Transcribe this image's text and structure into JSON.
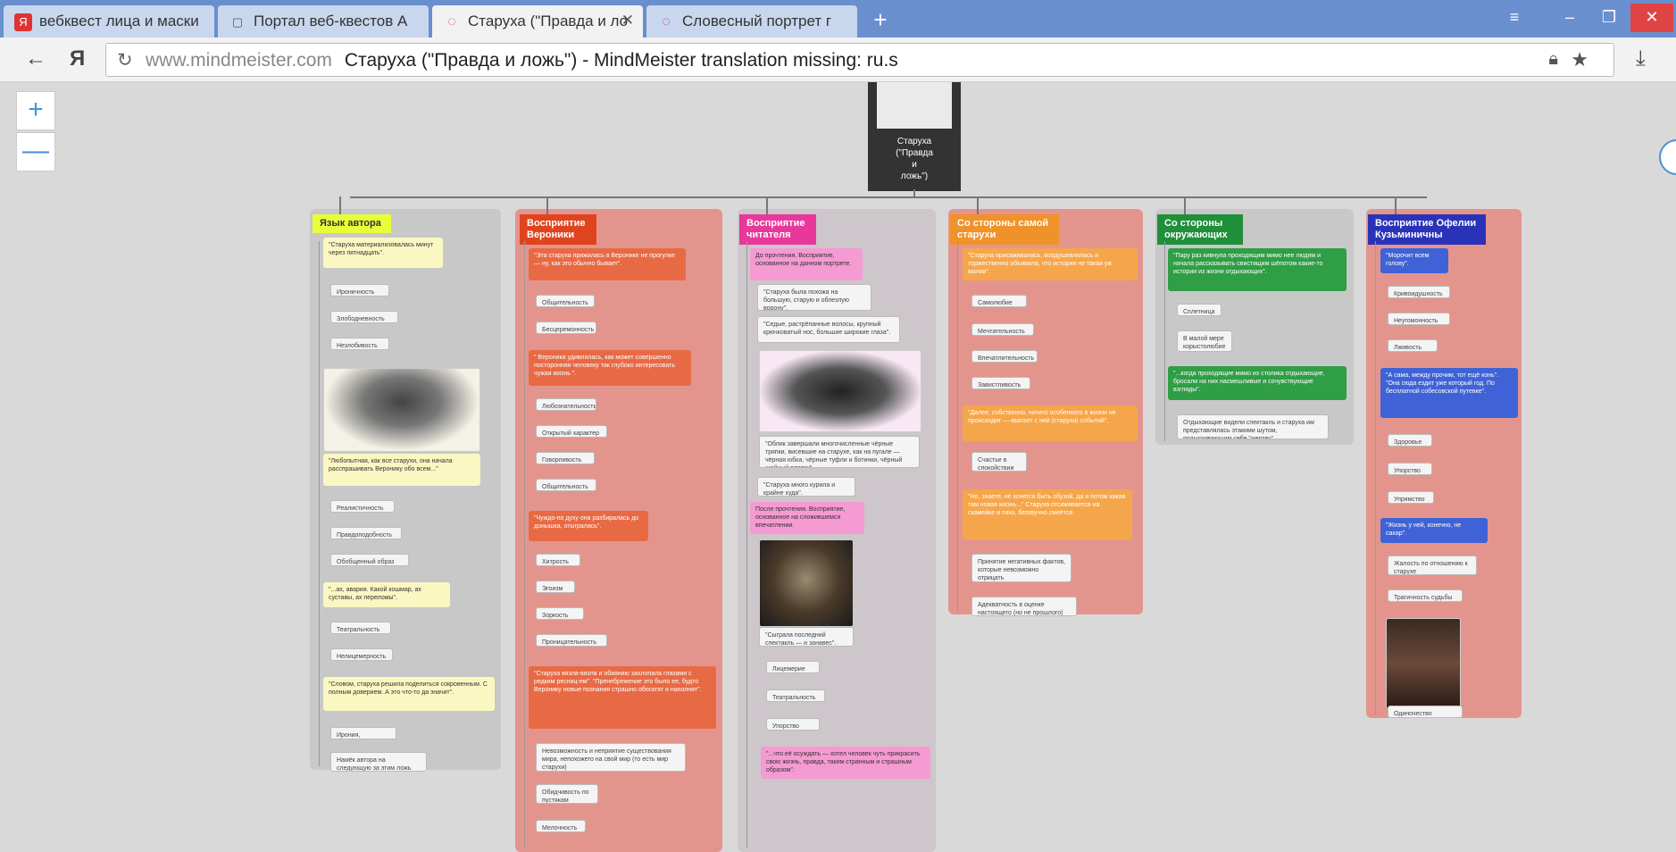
{
  "tabs": [
    {
      "label": "вебквест лица и маски",
      "icon": "Я"
    },
    {
      "label": "Портал веб-квестов А",
      "icon": "▢"
    },
    {
      "label": "Старуха (\"Правда и ло",
      "icon": "◌"
    },
    {
      "label": "Словесный портрет г",
      "icon": "◌"
    }
  ],
  "toolbar": {
    "back": "←",
    "brand": "Я",
    "domain": "www.mindmeister.com",
    "page_title": "Старуха (\"Правда и ложь\") - MindMeister translation missing: ru.s"
  },
  "zoom": {
    "plus": "+",
    "minus": "—"
  },
  "root": {
    "lines": [
      "Старуха",
      "(\"Правда",
      "и",
      "ложь\")"
    ]
  },
  "columns": [
    {
      "title": "Язык автора",
      "color": "#e8ff3a",
      "bg": "#c8c8c8"
    },
    {
      "title": "Восприятие Вероники",
      "color": "#e0441f",
      "bg": "#e3958d"
    },
    {
      "title": "Восприятие читателя",
      "color": "#e8389b",
      "bg": "#cdc6ca"
    },
    {
      "title": "Со стороны самой старухи",
      "color": "#f0922a",
      "bg": "#e3958d"
    },
    {
      "title": "Со стороны окружающих",
      "color": "#1f8f3a",
      "bg": "#c8c8c8"
    },
    {
      "title": "Восприятие Офелии Кузьминичны",
      "color": "#2a33b8",
      "bg": "#e3958d"
    }
  ],
  "nodes": {
    "c1": [
      "\"Старуха материализовалась минут через пятнадцать\".",
      "Ироничность",
      "Злободневность",
      "Незлобивость",
      "\"Любопытная, как все старухи, она начала расспрашивать Веронику обо всем...\"",
      "Реалистичность",
      "Правдоподобность",
      "Обобщенный образ",
      "\"...ах, авария. Какой кошмар, ах суставы, ах переломы\".",
      "Театральность",
      "Нелицемерность",
      "\"Словом, старуха решила поделиться сокровенным. С полным доверием. А это что-то да значит\".",
      "Ирония, насмешка",
      "Намёк автора на следующую за этим ложь"
    ],
    "c2": [
      "\"Эта старуха прижилась в Веронике не прогулке — ну, как это обычно бывает\".",
      "Общительность",
      "Бесцеремонность",
      "\" Вероника удивлялась, как может совершенно посторонняя человеку так глубоко интересовать чужая жизнь \".",
      "Любознательность",
      "Открытый характер",
      "Говорливость",
      "Общительность",
      "\"Чуждо-по духу она разбиралась до донышка, отыгралась\".",
      "Хитрость",
      "Эгоизм",
      "Зоркость",
      "Проницательность",
      "\"Старуха вязла-вязла и обаянию захлопала глазами с редким ресниц-ем\". \"Пренебрежение это было ее, будто Веронику новые познания страшно обогатят и наполнят\".",
      "Невозможность и неприятие существования мира, непохожего на свой мир (то есть мир старухи)",
      "Обидчивость по пустякам",
      "Мелочность"
    ],
    "c3": [
      "До прочтения. Восприятие, основанное на данном портрете.",
      "\"Старуха была похожа на большую, старую и облезлую ворону\".",
      "\"Седые, растрёпанные волосы, крупный крючковатый нос, большие широкие глаза\".",
      "\"Облик завершали многочисленные чёрные тряпки, висевшие на старухе, как на пугале — чёрная юбка, чёрные туфли и ботинки, чёрный шейный платок\".",
      "\"Старуха много курила и крайне худа\".",
      "После прочтения. Восприятие, основанное на сложившемся впечатлении.",
      "\"Сыграла последний спектакль — и занавес\".",
      "Лицемерие",
      "Театральность",
      "Упорство",
      "\"...что её осуждать — хотел человек чуть прикрасить свою жизнь, правда, таким странным и страшным образом\"."
    ],
    "c4": [
      "\"Старуха присаживалась, воодушевлялась и торжественно объявила, что история не такая уж малая\".",
      "Самолюбие",
      "Мечтательность",
      "Впечатлительность",
      "Завистливость",
      "\"Далее, собственно, ничего особенного в жизни не происходит — кватает с ней (старухи) событий\".",
      "Счастье в спокойствии",
      "\"Но, знаете, не хочется быть обузой, да и потом какая там новая жизнь...\" Старуха отсиживается на скамейке и тихо, беззвучно смеётся.",
      "Принятие негативных фактов, которые невозможно отрицать",
      "Адекватность в оценке настоящего (но не прошлого)"
    ],
    "c5": [
      "\"Пару раз кивнула проходящим мимо нее людям и начала рассказывать свистящим шёпотом какие-то истории из жизни отдыхающих\".",
      "Сплетница",
      "В малой мере корыстолюбие",
      "\"...когда проходящие мимо их столика отдыхающие, бросали на них насмешливые и сочувствующие взгляды\".",
      "Отдыхающие видели спектакль и старуха им представлялась этакими шутом, подыскивающим себе \"жертву\""
    ],
    "c6": [
      "\"Морочит всем голову\".",
      "Кривоидушность",
      "Неугомонность",
      "Лживость",
      "\"А сама, между прочим, тот ещё конь\". \"Она сюда ездит уже который год. По бесплатной собесовской путевке\".",
      "Здоровье",
      "Упорство",
      "Упрямство",
      "\"Жизнь у ней, конечно, не сахар\".",
      "Жалость по отношению к старухе",
      "Трагичность судьбы",
      "Одиночество"
    ]
  }
}
